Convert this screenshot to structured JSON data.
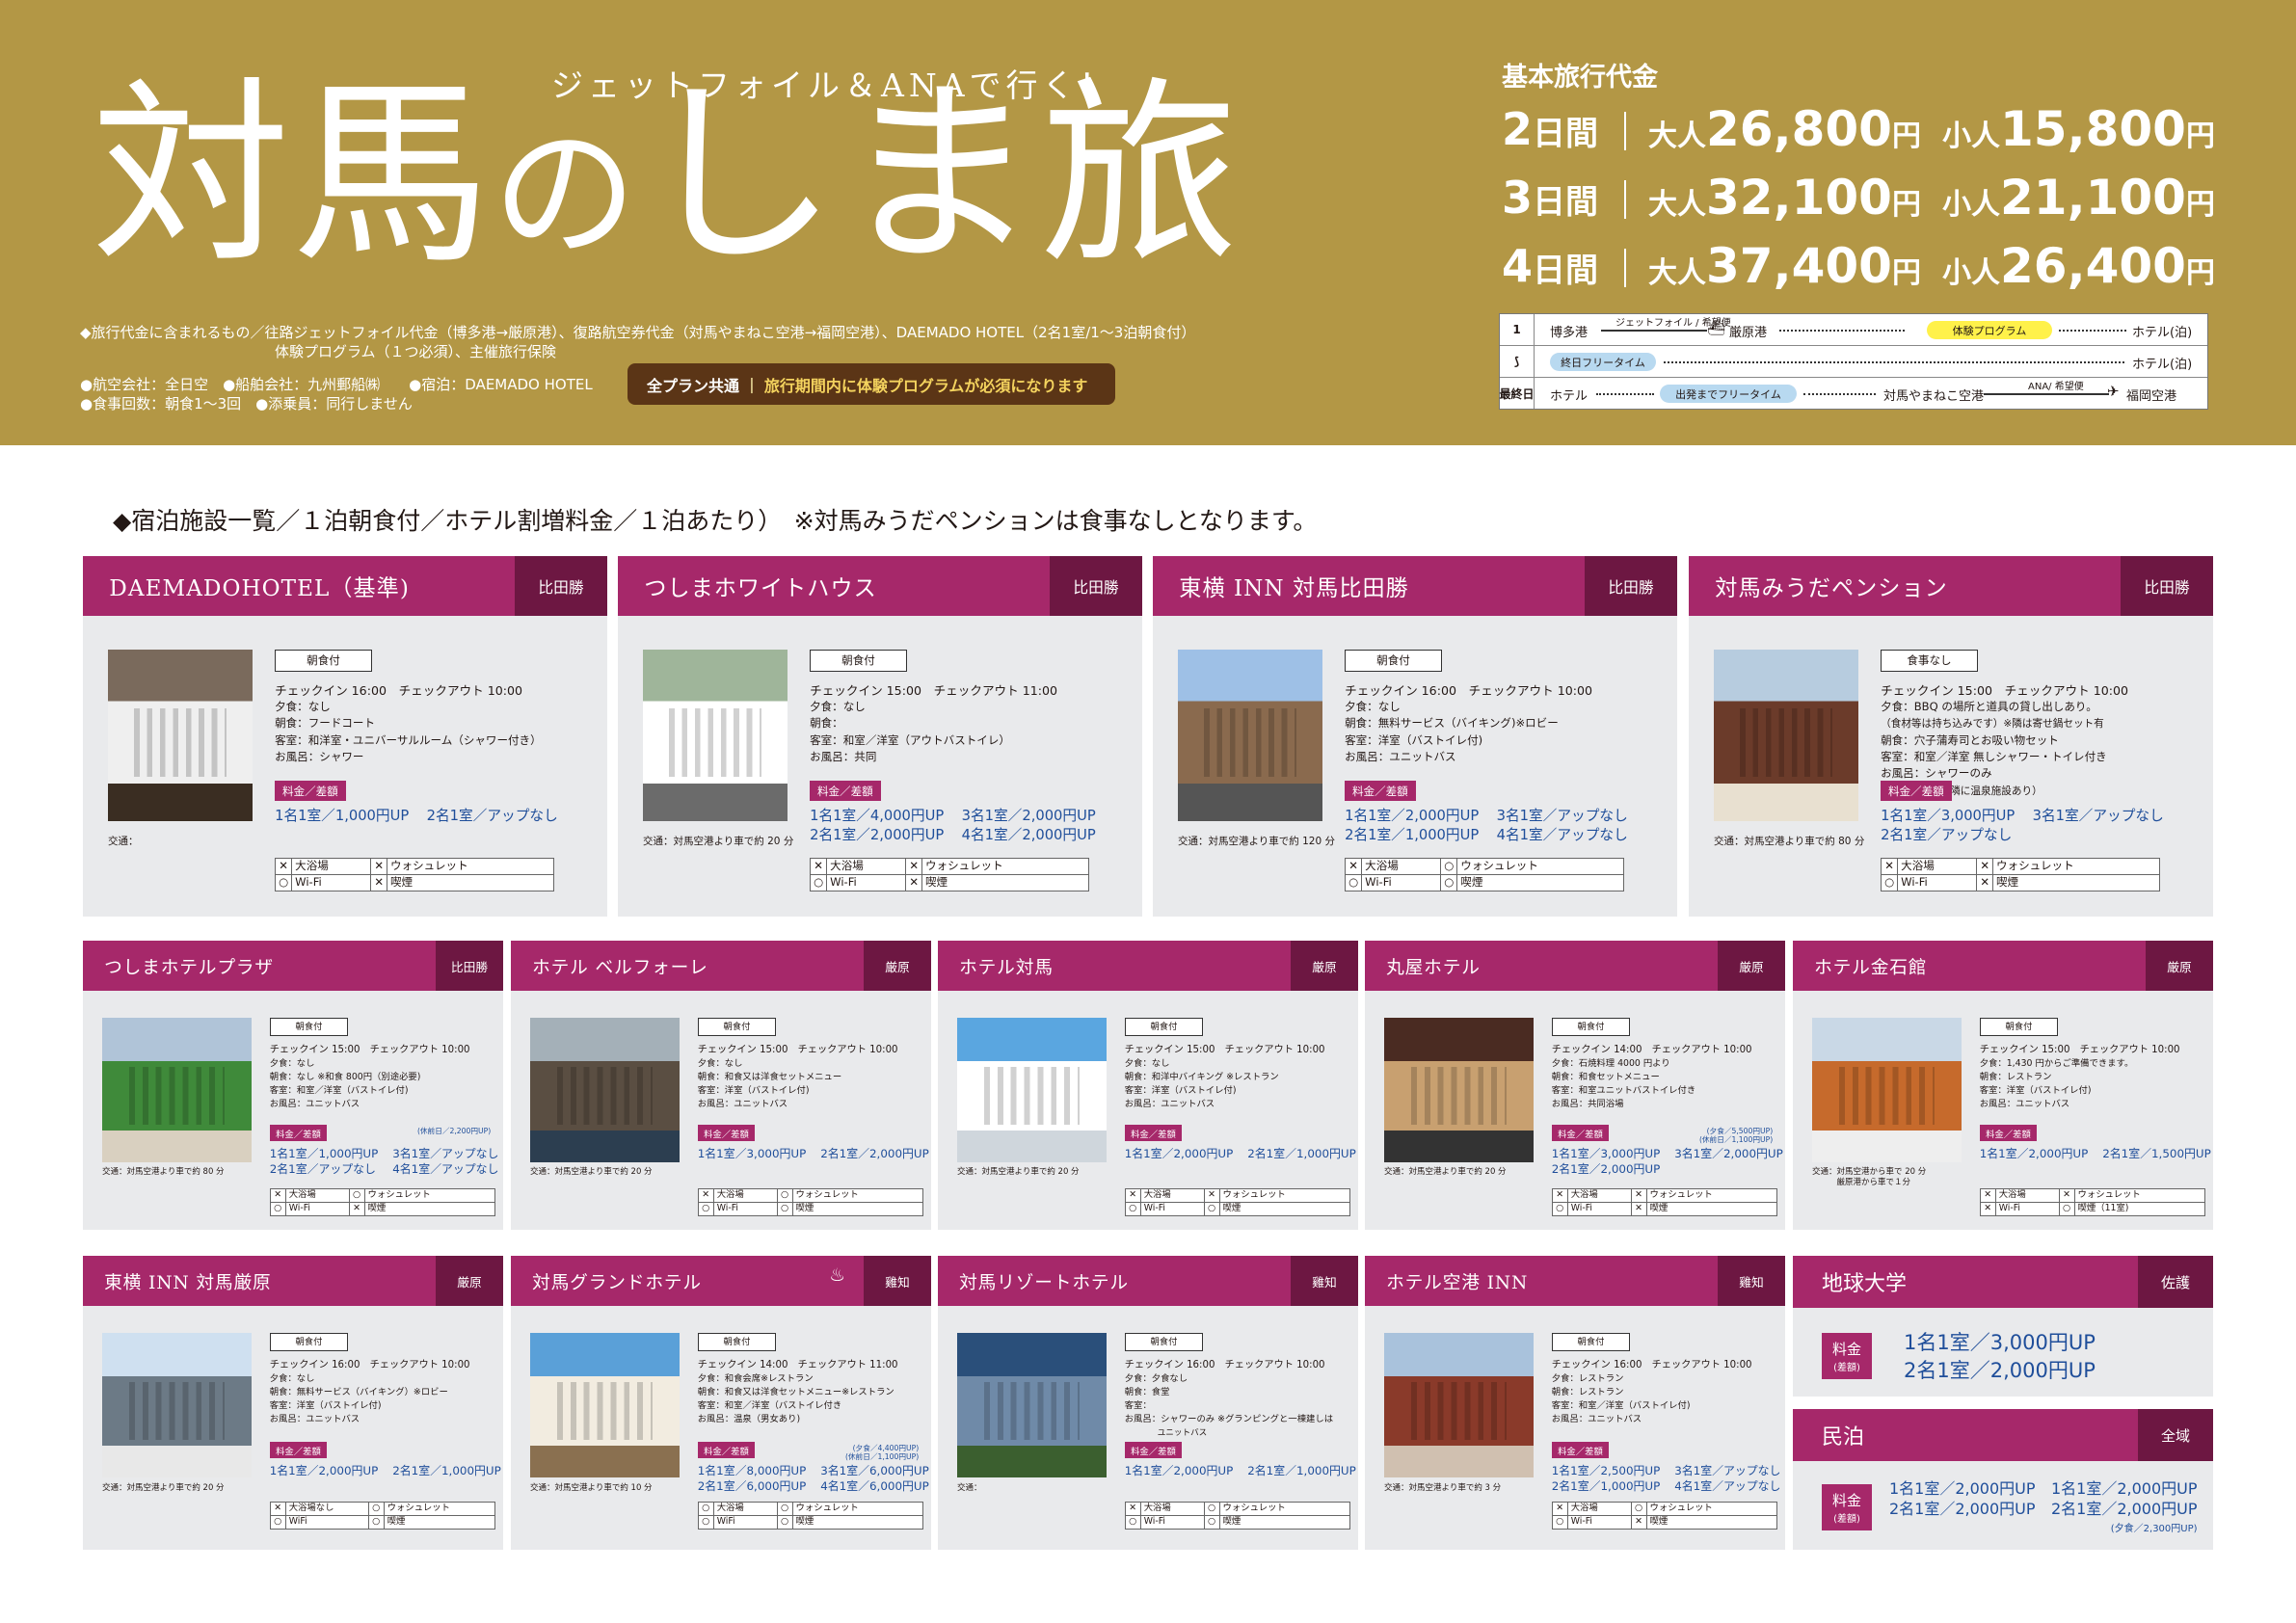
{
  "header": {
    "subtitle": "ジェットフォイル＆ANAで行く！",
    "title_a": "対馬",
    "title_no": "の",
    "title_b": "しま旅",
    "inclusion_1": "◆旅行代金に含まれるもの／往路ジェットフォイル代金（博多港→厳原港）、復路航空券代金（対馬やまねこ空港→福岡空港）、DAEMADO HOTEL（2名1室/1〜3泊朝食付）",
    "inclusion_2": "体験プログラム（１つ必須）、主催旅行保険",
    "info_1": "●航空会社：全日空　●船舶会社：九州郵船㈱　　●宿泊：DAEMADO HOTEL",
    "info_2": "●食事回数：朝食1〜3回　●添乗員：同行しません",
    "badge_a": "全プラン共通",
    "badge_b": "旅行期間内に体験プログラムが必須になります"
  },
  "prices": {
    "heading": "基本旅行代金",
    "rows": [
      {
        "days": "2",
        "unit": "日間",
        "adult_label": "大人",
        "adult": "26,800",
        "child_label": "小人",
        "child": "15,800",
        "yen": "円"
      },
      {
        "days": "3",
        "unit": "日間",
        "adult_label": "大人",
        "adult": "32,100",
        "child_label": "小人",
        "child": "21,100",
        "yen": "円"
      },
      {
        "days": "4",
        "unit": "日間",
        "adult_label": "大人",
        "adult": "37,400",
        "child_label": "小人",
        "child": "26,400",
        "yen": "円"
      }
    ]
  },
  "schedule": {
    "r1": {
      "day": "1",
      "a": "博多港",
      "jet": "ジェットフォイル / 希望便",
      "b": "厳原港",
      "prog": "体験プログラム",
      "hotel": "ホテル(泊)"
    },
    "r2": {
      "day": "⟆",
      "free": "終日フリータイム",
      "hotel": "ホテル(泊)"
    },
    "r3": {
      "day": "最終日",
      "a": "ホテル",
      "free": "出発までフリータイム",
      "b": "対馬やまねこ空港",
      "ana": "ANA/ 希望便",
      "c": "福岡空港"
    }
  },
  "lead": "◆宿泊施設一覧／１泊朝食付／ホテル割増料金／１泊あたり）　※対馬みうだペンションは食事なしとなります。",
  "labels": {
    "checkin": "チェックイン",
    "checkout": "チェックアウト",
    "rate": "料金／差額",
    "dinner": "夕食：",
    "bfast": "朝食：",
    "room": "客室：",
    "bath": "お風呂：",
    "fee": "料金",
    "fee2": "(差額)"
  },
  "hotels": [
    {
      "name": "DAEMADOHOTEL（基準)",
      "area": "比田勝",
      "meal": "朝食付",
      "ci": "16:00",
      "co": "10:00",
      "dinner": "なし",
      "bfast": "フードコート",
      "room": "和洋室・ユニバーサルルーム（シャワー付き）",
      "bath": "シャワー",
      "r1": "1名1室／1,000円UP",
      "r2": "2名1室／アップなし",
      "r3": "",
      "r4": "",
      "note": "",
      "trn": "交通：",
      "a1": "大浴場",
      "a1m": "✕",
      "a2": "ウォシュレット",
      "a2m": "✕",
      "a3": "Wi-Fi",
      "a3m": "○",
      "a4": "喫煙",
      "a4m": "✕"
    },
    {
      "name": "つしまホワイトハウス",
      "area": "比田勝",
      "meal": "朝食付",
      "ci": "15:00",
      "co": "11:00",
      "dinner": "なし",
      "bfast": "",
      "room": "和室／洋室（アウトバストイレ）",
      "bath": "共同",
      "r1": "1名1室／4,000円UP",
      "r2": "3名1室／2,000円UP",
      "r3": "2名1室／2,000円UP",
      "r4": "4名1室／2,000円UP",
      "note": "",
      "trn": "交通：対馬空港より車で約 20 分",
      "a1": "大浴場",
      "a1m": "✕",
      "a2": "ウォシュレット",
      "a2m": "✕",
      "a3": "Wi-Fi",
      "a3m": "○",
      "a4": "喫煙",
      "a4m": "✕"
    },
    {
      "name": "東横 INN 対馬比田勝",
      "area": "比田勝",
      "meal": "朝食付",
      "ci": "16:00",
      "co": "10:00",
      "dinner": "なし",
      "bfast": "無料サービス（バイキング)※ロビー",
      "room": "洋室（バストイレ付)",
      "bath": "ユニットバス",
      "r1": "1名1室／2,000円UP",
      "r2": "3名1室／アップなし",
      "r3": "2名1室／1,000円UP",
      "r4": "4名1室／アップなし",
      "note": "",
      "trn": "交通：対馬空港より車で約 120 分",
      "a1": "大浴場",
      "a1m": "✕",
      "a2": "ウォシュレット",
      "a2m": "○",
      "a3": "Wi-Fi",
      "a3m": "○",
      "a4": "喫煙",
      "a4m": "○"
    },
    {
      "name": "対馬みうだペンション",
      "area": "比田勝",
      "meal": "食事なし",
      "ci": "15:00",
      "co": "10:00",
      "dinner": "BBQ の場所と道具の貸し出しあり。",
      "dinner2": "（食材等は持ち込みです）※隣は寄せ鍋セット有",
      "bfast": "穴子蒲寿司とお吸い物セット",
      "room": "和室／洋室 無しシャワー・トイレ付き",
      "bath": "シャワーのみ",
      "bath2": "（※近隣に温泉施設あり）",
      "r1": "1名1室／3,000円UP",
      "r2": "3名1室／アップなし",
      "r3": "2名1室／アップなし",
      "r4": "",
      "note": "",
      "trn": "交通：対馬空港より車で約 80 分",
      "a1": "大浴場",
      "a1m": "✕",
      "a2": "ウォシュレット",
      "a2m": "✕",
      "a3": "Wi-Fi",
      "a3m": "○",
      "a4": "喫煙",
      "a4m": "✕"
    },
    {
      "name": "つしまホテルプラザ",
      "area": "比田勝",
      "meal": "朝食付",
      "ci": "15:00",
      "co": "10:00",
      "dinner": "なし",
      "bfast": "なし ※和食 800円（別途必要)",
      "room": "和室／洋室（バストイレ付)",
      "bath": "ユニットバス",
      "r1": "1名1室／1,000円UP",
      "r2": "3名1室／アップなし",
      "r3": "2名1室／アップなし",
      "r4": "4名1室／アップなし",
      "note": "(休前日／2,200円UP)",
      "trn": "交通：対馬空港より車で約 80 分",
      "a1": "大浴場",
      "a1m": "✕",
      "a2": "ウォシュレット",
      "a2m": "○",
      "a3": "Wi-Fi",
      "a3m": "○",
      "a4": "喫煙",
      "a4m": "✕"
    },
    {
      "name": "ホテル ベルフォーレ",
      "area": "厳原",
      "meal": "朝食付",
      "ci": "15:00",
      "co": "10:00",
      "dinner": "なし",
      "bfast": "和食又は洋食セットメニュー",
      "room": "洋室（バストイレ付)",
      "bath": "ユニットバス",
      "r1": "1名1室／3,000円UP",
      "r2": "2名1室／2,000円UP",
      "r3": "",
      "r4": "",
      "note": "",
      "trn": "交通：対馬空港より車で約 20 分",
      "a1": "大浴場",
      "a1m": "✕",
      "a2": "ウォシュレット",
      "a2m": "○",
      "a3": "Wi-Fi",
      "a3m": "○",
      "a4": "喫煙",
      "a4m": "○"
    },
    {
      "name": "ホテル対馬",
      "area": "厳原",
      "meal": "朝食付",
      "ci": "15:00",
      "co": "10:00",
      "dinner": "なし",
      "bfast": "和洋中バイキング ※レストラン",
      "room": "洋室（バストイレ付)",
      "bath": "ユニットバス",
      "r1": "1名1室／2,000円UP",
      "r2": "2名1室／1,000円UP",
      "r3": "",
      "r4": "",
      "note": "",
      "trn": "交通：対馬空港より車で約 20 分",
      "a1": "大浴場",
      "a1m": "✕",
      "a2": "ウォシュレット",
      "a2m": "✕",
      "a3": "Wi-Fi",
      "a3m": "○",
      "a4": "喫煙",
      "a4m": "○"
    },
    {
      "name": "丸屋ホテル",
      "area": "厳原",
      "meal": "朝食付",
      "ci": "14:00",
      "co": "10:00",
      "dinner": "石焼料理 4000 円より",
      "bfast": "和食セットメニュー",
      "room": "和室ユニットバストイレ付き",
      "bath": "共同浴場",
      "r1": "1名1室／3,000円UP",
      "r2": "3名1室／2,000円UP",
      "r3": "2名1室／2,000円UP",
      "r4": "",
      "note": "(夕食／5,500円UP)",
      "note2": "(休前日／1,100円UP)",
      "trn": "交通：対馬空港より車で約 20 分",
      "a1": "大浴場",
      "a1m": "✕",
      "a2": "ウォシュレット",
      "a2m": "✕",
      "a3": "Wi-Fi",
      "a3m": "○",
      "a4": "喫煙",
      "a4m": "✕"
    },
    {
      "name": "ホテル金石館",
      "area": "厳原",
      "meal": "朝食付",
      "ci": "15:00",
      "co": "10:00",
      "dinner": "1,430 円からご準備できます。",
      "bfast": "レストラン",
      "room": "洋室（バストイレ付)",
      "bath": "ユニットバス",
      "r1": "1名1室／2,000円UP",
      "r2": "2名1室／1,500円UP",
      "r3": "",
      "r4": "",
      "note": "",
      "trn": "交通：対馬空港から車で 20 分",
      "trn2": "厳原港から車で１分",
      "a1": "大浴場",
      "a1m": "✕",
      "a2": "ウォシュレット",
      "a2m": "✕",
      "a3": "Wi-Fi",
      "a3m": "✕",
      "a4": "喫煙（11室)",
      "a4m": "○"
    },
    {
      "name": "東横 INN 対馬厳原",
      "area": "厳原",
      "meal": "朝食付",
      "ci": "16:00",
      "co": "10:00",
      "dinner": "なし",
      "bfast": "無料サービス（バイキング）※ロビー",
      "room": "洋室（バストイレ付)",
      "bath": "ユニットバス",
      "r1": "1名1室／2,000円UP",
      "r2": "2名1室／1,000円UP",
      "r3": "",
      "r4": "",
      "note": "",
      "trn": "交通：対馬空港より車で約 20 分",
      "a1": "大浴場なし",
      "a1m": "✕",
      "a2": "ウォシュレット",
      "a2m": "○",
      "a3": "WiFi",
      "a3m": "○",
      "a4": "喫煙",
      "a4m": "○"
    },
    {
      "name": "対馬グランドホテル",
      "area": "雞知",
      "meal": "朝食付",
      "ci": "14:00",
      "co": "11:00",
      "dinner": "和食会席※レストラン",
      "bfast": "和食又は洋食セットメニュー※レストラン",
      "room": "和室／洋室（バストイレ付き",
      "bath": "温泉（男女あり)",
      "r1": "1名1室／8,000円UP",
      "r2": "3名1室／6,000円UP",
      "r3": "2名1室／6,000円UP",
      "r4": "4名1室／6,000円UP",
      "note": "(夕食／4,400円UP)",
      "note2": "(休前日／1,100円UP)",
      "trn": "交通：対馬空港より車で約 10 分",
      "a1": "大浴場",
      "a1m": "○",
      "a2": "ウォシュレット",
      "a2m": "○",
      "a3": "WiFi",
      "a3m": "○",
      "a4": "喫煙",
      "a4m": "○"
    },
    {
      "name": "対馬リゾートホテル",
      "area": "雞知",
      "meal": "朝食付",
      "ci": "16:00",
      "co": "10:00",
      "dinner": "夕食なし",
      "bfast": "食堂",
      "room": "",
      "bath": "シャワーのみ ※グランピングと一棟建しは",
      "bath2": "ユニットバス",
      "r1": "1名1室／2,000円UP",
      "r2": "2名1室／1,000円UP",
      "r3": "",
      "r4": "",
      "note": "",
      "trn": "交通：",
      "a1": "大浴場",
      "a1m": "✕",
      "a2": "ウォシュレット",
      "a2m": "○",
      "a3": "Wi-Fi",
      "a3m": "○",
      "a4": "喫煙",
      "a4m": "○"
    },
    {
      "name": "ホテル空港 INN",
      "area": "雞知",
      "meal": "朝食付",
      "ci": "16:00",
      "co": "10:00",
      "dinner": "レストラン",
      "bfast": "レストラン",
      "room": "和室／洋室（バストイレ付)",
      "bath": "ユニットバス",
      "r1": "1名1室／2,500円UP",
      "r2": "3名1室／アップなし",
      "r3": "2名1室／1,000円UP",
      "r4": "4名1室／アップなし",
      "note": "",
      "trn": "交通：対馬空港より車で約 3 分",
      "a1": "大浴場",
      "a1m": "✕",
      "a2": "ウォシュレット",
      "a2m": "○",
      "a3": "Wi-Fi",
      "a3m": "○",
      "a4": "喫煙",
      "a4m": "✕"
    }
  ],
  "chikyu": {
    "name": "地球大学",
    "area": "佐護",
    "r1": "1名1室／3,000円UP",
    "r2": "2名1室／2,000円UP"
  },
  "minpaku": {
    "name": "民泊",
    "area": "全域",
    "r1": "1名1室／2,000円UP",
    "r2": "1名1室／2,000円UP",
    "r3": "2名1室／2,000円UP",
    "r4": "2名1室／2,000円UP",
    "note": "(夕食／2,300円UP)"
  },
  "icons": {
    "onsen": "hot-spring-icon",
    "arrow": "airplane-icon",
    "ship": "ship-icon"
  },
  "colors": {
    "header": "#b39745",
    "card_header": "#a6286a",
    "card_tag": "#6d1742",
    "card_bg": "#e9eaec",
    "rate_text": "#1f4e9a"
  }
}
